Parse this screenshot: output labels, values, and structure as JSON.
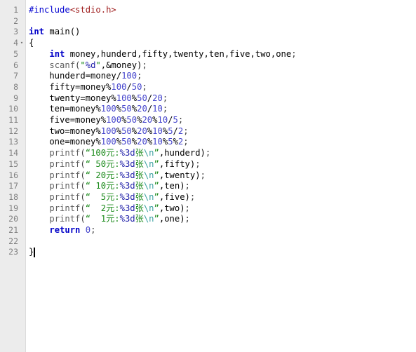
{
  "editor": {
    "title": "C source editor",
    "language": "C",
    "total_lines": 23,
    "current_line": 23,
    "caret_line": 23,
    "caret_column": 2,
    "colors": {
      "background": "#ffffff",
      "gutter_background": "#ececec",
      "gutter_border": "#dcdcdc",
      "line_number": "#808080",
      "current_line_highlight": "#ededed",
      "preprocessor": "#0000d0",
      "header": "#a02020",
      "keyword": "#0000c8",
      "function": "#606060",
      "number": "#4444cc",
      "string": "#1a8a1a",
      "format_spec": "#2222aa",
      "escape": "#3aa0a0",
      "identifier": "#000000",
      "indent_guide": "#d8d8d8"
    }
  },
  "gutter": {
    "line_numbers": [
      "1",
      "2",
      "3",
      "4",
      "5",
      "6",
      "7",
      "8",
      "9",
      "10",
      "11",
      "12",
      "13",
      "14",
      "15",
      "16",
      "17",
      "18",
      "19",
      "20",
      "21",
      "22",
      "23"
    ],
    "fold_marker_line": 4,
    "fold_marker_glyph": "▾"
  },
  "code": {
    "lines": [
      {
        "n": 1,
        "text": "#include<stdio.h>"
      },
      {
        "n": 2,
        "text": ""
      },
      {
        "n": 3,
        "text": "int main()"
      },
      {
        "n": 4,
        "text": "{"
      },
      {
        "n": 5,
        "text": "    int money,hunderd,fifty,twenty,ten,five,two,one;"
      },
      {
        "n": 6,
        "text": "    scanf(\"%d\",&money);"
      },
      {
        "n": 7,
        "text": "    hunderd=money/100;"
      },
      {
        "n": 8,
        "text": "    fifty=money%100/50;"
      },
      {
        "n": 9,
        "text": "    twenty=money%100%50/20;"
      },
      {
        "n": 10,
        "text": "    ten=money%100%50%20/10;"
      },
      {
        "n": 11,
        "text": "    five=money%100%50%20%10/5;"
      },
      {
        "n": 12,
        "text": "    two=money%100%50%20%10%5/2;"
      },
      {
        "n": 13,
        "text": "    one=money%100%50%20%10%5%2;"
      },
      {
        "n": 14,
        "text": "    printf(\"100元:%3d张\\n\",hunderd);"
      },
      {
        "n": 15,
        "text": "    printf(\" 50元:%3d张\\n\",fifty);"
      },
      {
        "n": 16,
        "text": "    printf(\" 20元:%3d张\\n\",twenty);"
      },
      {
        "n": 17,
        "text": "    printf(\" 10元:%3d张\\n\",ten);"
      },
      {
        "n": 18,
        "text": "    printf(\"  5元:%3d张\\n\",five);"
      },
      {
        "n": 19,
        "text": "    printf(\"  2元:%3d张\\n\",two);"
      },
      {
        "n": 20,
        "text": "    printf(\"  1元:%3d张\\n\",one);"
      },
      {
        "n": 21,
        "text": "    return 0;"
      },
      {
        "n": 22,
        "text": ""
      },
      {
        "n": 23,
        "text": "}"
      }
    ],
    "tokens": [
      [
        {
          "t": "#include",
          "c": "t-pre"
        },
        {
          "t": "<stdio.h>",
          "c": "t-header"
        }
      ],
      [],
      [
        {
          "t": "int",
          "c": "t-kw"
        },
        {
          "t": " main()",
          "c": "t-id"
        }
      ],
      [
        {
          "t": "{",
          "c": "t-brace"
        }
      ],
      [
        {
          "t": "    ",
          "c": "t-id"
        },
        {
          "t": "int",
          "c": "t-kw"
        },
        {
          "t": " money,hunderd,fifty,twenty,ten,five,two,one",
          "c": "t-id"
        },
        {
          "t": ";",
          "c": "t-punct"
        }
      ],
      [
        {
          "t": "    ",
          "c": "t-id"
        },
        {
          "t": "scanf",
          "c": "t-fn"
        },
        {
          "t": "(",
          "c": "t-punct"
        },
        {
          "t": "\"",
          "c": "t-str"
        },
        {
          "t": "%d",
          "c": "t-fmt"
        },
        {
          "t": "\"",
          "c": "t-str"
        },
        {
          "t": ",&money)",
          "c": "t-id"
        },
        {
          "t": ";",
          "c": "t-punct"
        }
      ],
      [
        {
          "t": "    hunderd=money/",
          "c": "t-id"
        },
        {
          "t": "100",
          "c": "t-num"
        },
        {
          "t": ";",
          "c": "t-punct"
        }
      ],
      [
        {
          "t": "    fifty=money%",
          "c": "t-id"
        },
        {
          "t": "100",
          "c": "t-num"
        },
        {
          "t": "/",
          "c": "t-id"
        },
        {
          "t": "50",
          "c": "t-num"
        },
        {
          "t": ";",
          "c": "t-punct"
        }
      ],
      [
        {
          "t": "    twenty=money%",
          "c": "t-id"
        },
        {
          "t": "100",
          "c": "t-num"
        },
        {
          "t": "%",
          "c": "t-id"
        },
        {
          "t": "50",
          "c": "t-num"
        },
        {
          "t": "/",
          "c": "t-id"
        },
        {
          "t": "20",
          "c": "t-num"
        },
        {
          "t": ";",
          "c": "t-punct"
        }
      ],
      [
        {
          "t": "    ten=money%",
          "c": "t-id"
        },
        {
          "t": "100",
          "c": "t-num"
        },
        {
          "t": "%",
          "c": "t-id"
        },
        {
          "t": "50",
          "c": "t-num"
        },
        {
          "t": "%",
          "c": "t-id"
        },
        {
          "t": "20",
          "c": "t-num"
        },
        {
          "t": "/",
          "c": "t-id"
        },
        {
          "t": "10",
          "c": "t-num"
        },
        {
          "t": ";",
          "c": "t-punct"
        }
      ],
      [
        {
          "t": "    five=money%",
          "c": "t-id"
        },
        {
          "t": "100",
          "c": "t-num"
        },
        {
          "t": "%",
          "c": "t-id"
        },
        {
          "t": "50",
          "c": "t-num"
        },
        {
          "t": "%",
          "c": "t-id"
        },
        {
          "t": "20",
          "c": "t-num"
        },
        {
          "t": "%",
          "c": "t-id"
        },
        {
          "t": "10",
          "c": "t-num"
        },
        {
          "t": "/",
          "c": "t-id"
        },
        {
          "t": "5",
          "c": "t-num"
        },
        {
          "t": ";",
          "c": "t-punct"
        }
      ],
      [
        {
          "t": "    two=money%",
          "c": "t-id"
        },
        {
          "t": "100",
          "c": "t-num"
        },
        {
          "t": "%",
          "c": "t-id"
        },
        {
          "t": "50",
          "c": "t-num"
        },
        {
          "t": "%",
          "c": "t-id"
        },
        {
          "t": "20",
          "c": "t-num"
        },
        {
          "t": "%",
          "c": "t-id"
        },
        {
          "t": "10",
          "c": "t-num"
        },
        {
          "t": "%",
          "c": "t-id"
        },
        {
          "t": "5",
          "c": "t-num"
        },
        {
          "t": "/",
          "c": "t-id"
        },
        {
          "t": "2",
          "c": "t-num"
        },
        {
          "t": ";",
          "c": "t-punct"
        }
      ],
      [
        {
          "t": "    one=money%",
          "c": "t-id"
        },
        {
          "t": "100",
          "c": "t-num"
        },
        {
          "t": "%",
          "c": "t-id"
        },
        {
          "t": "50",
          "c": "t-num"
        },
        {
          "t": "%",
          "c": "t-id"
        },
        {
          "t": "20",
          "c": "t-num"
        },
        {
          "t": "%",
          "c": "t-id"
        },
        {
          "t": "10",
          "c": "t-num"
        },
        {
          "t": "%",
          "c": "t-id"
        },
        {
          "t": "5",
          "c": "t-num"
        },
        {
          "t": "%",
          "c": "t-id"
        },
        {
          "t": "2",
          "c": "t-num"
        },
        {
          "t": ";",
          "c": "t-punct"
        }
      ],
      [
        {
          "t": "    ",
          "c": "t-id"
        },
        {
          "t": "printf",
          "c": "t-fn"
        },
        {
          "t": "(",
          "c": "t-punct"
        },
        {
          "t": "“100",
          "c": "t-str"
        },
        {
          "t": "元",
          "c": "t-cjk"
        },
        {
          "t": ":",
          "c": "t-str"
        },
        {
          "t": "%3d",
          "c": "t-fmt"
        },
        {
          "t": "张",
          "c": "t-cjk"
        },
        {
          "t": "\\n",
          "c": "t-esc"
        },
        {
          "t": "”",
          "c": "t-str"
        },
        {
          "t": ",hunderd)",
          "c": "t-id"
        },
        {
          "t": ";",
          "c": "t-punct"
        }
      ],
      [
        {
          "t": "    ",
          "c": "t-id"
        },
        {
          "t": "printf",
          "c": "t-fn"
        },
        {
          "t": "(",
          "c": "t-punct"
        },
        {
          "t": "“ 50",
          "c": "t-str"
        },
        {
          "t": "元",
          "c": "t-cjk"
        },
        {
          "t": ":",
          "c": "t-str"
        },
        {
          "t": "%3d",
          "c": "t-fmt"
        },
        {
          "t": "张",
          "c": "t-cjk"
        },
        {
          "t": "\\n",
          "c": "t-esc"
        },
        {
          "t": "”",
          "c": "t-str"
        },
        {
          "t": ",fifty)",
          "c": "t-id"
        },
        {
          "t": ";",
          "c": "t-punct"
        }
      ],
      [
        {
          "t": "    ",
          "c": "t-id"
        },
        {
          "t": "printf",
          "c": "t-fn"
        },
        {
          "t": "(",
          "c": "t-punct"
        },
        {
          "t": "“ 20",
          "c": "t-str"
        },
        {
          "t": "元",
          "c": "t-cjk"
        },
        {
          "t": ":",
          "c": "t-str"
        },
        {
          "t": "%3d",
          "c": "t-fmt"
        },
        {
          "t": "张",
          "c": "t-cjk"
        },
        {
          "t": "\\n",
          "c": "t-esc"
        },
        {
          "t": "”",
          "c": "t-str"
        },
        {
          "t": ",twenty)",
          "c": "t-id"
        },
        {
          "t": ";",
          "c": "t-punct"
        }
      ],
      [
        {
          "t": "    ",
          "c": "t-id"
        },
        {
          "t": "printf",
          "c": "t-fn"
        },
        {
          "t": "(",
          "c": "t-punct"
        },
        {
          "t": "“ 10",
          "c": "t-str"
        },
        {
          "t": "元",
          "c": "t-cjk"
        },
        {
          "t": ":",
          "c": "t-str"
        },
        {
          "t": "%3d",
          "c": "t-fmt"
        },
        {
          "t": "张",
          "c": "t-cjk"
        },
        {
          "t": "\\n",
          "c": "t-esc"
        },
        {
          "t": "”",
          "c": "t-str"
        },
        {
          "t": ",ten)",
          "c": "t-id"
        },
        {
          "t": ";",
          "c": "t-punct"
        }
      ],
      [
        {
          "t": "    ",
          "c": "t-id"
        },
        {
          "t": "printf",
          "c": "t-fn"
        },
        {
          "t": "(",
          "c": "t-punct"
        },
        {
          "t": "“  5",
          "c": "t-str"
        },
        {
          "t": "元",
          "c": "t-cjk"
        },
        {
          "t": ":",
          "c": "t-str"
        },
        {
          "t": "%3d",
          "c": "t-fmt"
        },
        {
          "t": "张",
          "c": "t-cjk"
        },
        {
          "t": "\\n",
          "c": "t-esc"
        },
        {
          "t": "”",
          "c": "t-str"
        },
        {
          "t": ",five)",
          "c": "t-id"
        },
        {
          "t": ";",
          "c": "t-punct"
        }
      ],
      [
        {
          "t": "    ",
          "c": "t-id"
        },
        {
          "t": "printf",
          "c": "t-fn"
        },
        {
          "t": "(",
          "c": "t-punct"
        },
        {
          "t": "“  2",
          "c": "t-str"
        },
        {
          "t": "元",
          "c": "t-cjk"
        },
        {
          "t": ":",
          "c": "t-str"
        },
        {
          "t": "%3d",
          "c": "t-fmt"
        },
        {
          "t": "张",
          "c": "t-cjk"
        },
        {
          "t": "\\n",
          "c": "t-esc"
        },
        {
          "t": "”",
          "c": "t-str"
        },
        {
          "t": ",two)",
          "c": "t-id"
        },
        {
          "t": ";",
          "c": "t-punct"
        }
      ],
      [
        {
          "t": "    ",
          "c": "t-id"
        },
        {
          "t": "printf",
          "c": "t-fn"
        },
        {
          "t": "(",
          "c": "t-punct"
        },
        {
          "t": "“  1",
          "c": "t-str"
        },
        {
          "t": "元",
          "c": "t-cjk"
        },
        {
          "t": ":",
          "c": "t-str"
        },
        {
          "t": "%3d",
          "c": "t-fmt"
        },
        {
          "t": "张",
          "c": "t-cjk"
        },
        {
          "t": "\\n",
          "c": "t-esc"
        },
        {
          "t": "”",
          "c": "t-str"
        },
        {
          "t": ",one)",
          "c": "t-id"
        },
        {
          "t": ";",
          "c": "t-punct"
        }
      ],
      [
        {
          "t": "    ",
          "c": "t-id"
        },
        {
          "t": "return",
          "c": "t-kw"
        },
        {
          "t": " ",
          "c": "t-id"
        },
        {
          "t": "0",
          "c": "t-num"
        },
        {
          "t": ";",
          "c": "t-punct"
        }
      ],
      [],
      [
        {
          "t": "}",
          "c": "t-brace"
        }
      ]
    ]
  }
}
